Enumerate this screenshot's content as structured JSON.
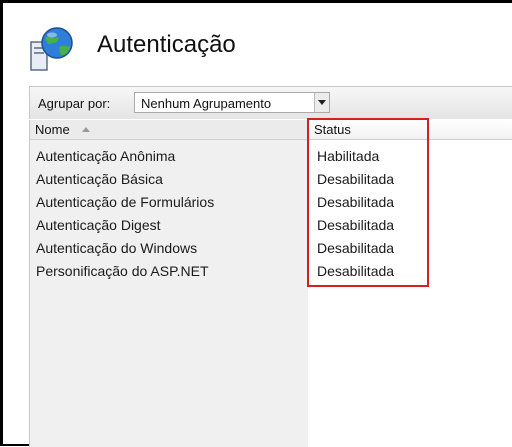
{
  "header": {
    "title": "Autenticação",
    "icon": "globe-server-icon"
  },
  "toolbar": {
    "group_label": "Agrupar por:",
    "group_value": "Nenhum Agrupamento"
  },
  "table": {
    "columns": [
      "Nome",
      "Status"
    ],
    "rows": [
      {
        "name": "Autenticação Anônima",
        "status": "Habilitada"
      },
      {
        "name": "Autenticação Básica",
        "status": "Desabilitada"
      },
      {
        "name": "Autenticação de Formulários",
        "status": "Desabilitada"
      },
      {
        "name": "Autenticação Digest",
        "status": "Desabilitada"
      },
      {
        "name": "Autenticação do Windows",
        "status": "Desabilitada"
      },
      {
        "name": "Personificação do ASP.NET",
        "status": "Desabilitada"
      }
    ]
  },
  "colors": {
    "highlight": "#d42020"
  }
}
